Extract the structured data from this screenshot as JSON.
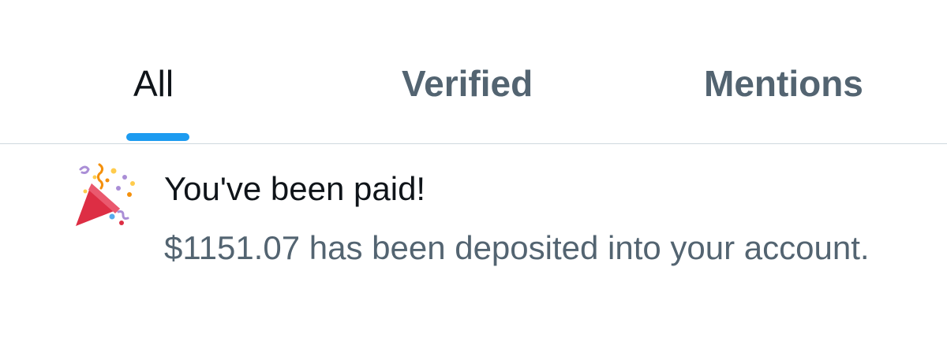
{
  "tabs": [
    {
      "label": "All",
      "selected": true
    },
    {
      "label": "Verified",
      "selected": false
    },
    {
      "label": "Mentions",
      "selected": false
    }
  ],
  "colors": {
    "accent": "#1d9bf0",
    "primary_text": "#0f1419",
    "secondary_text": "#536471",
    "divider": "#cfd9de"
  },
  "notification": {
    "icon": "party-popper-icon",
    "title": "You've been paid!",
    "body": "$1151.07 has been deposited into your account."
  }
}
